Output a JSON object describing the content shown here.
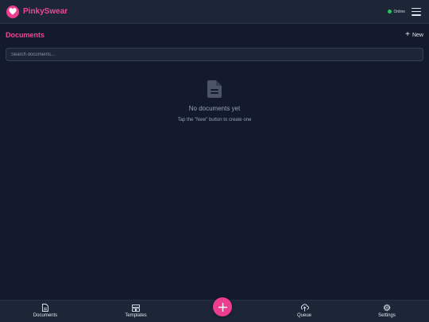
{
  "app": {
    "name": "PinkySwear",
    "status": "Online"
  },
  "colors": {
    "accent": "#ec4899",
    "background": "#131a2b",
    "bar": "#1c2636",
    "status": "#22c55e"
  },
  "header": {
    "title": "Documents",
    "new_label": "New",
    "new_icon": "plus-icon",
    "menu_icon": "hamburger-menu-icon"
  },
  "search": {
    "placeholder": "Search documents..."
  },
  "empty_state": {
    "icon": "document-icon",
    "title": "No documents yet",
    "subtitle": "Tap the \"New\" button to create one"
  },
  "nav": {
    "items": [
      {
        "label": "Documents",
        "icon": "document-icon"
      },
      {
        "label": "Templates",
        "icon": "templates-icon"
      },
      {
        "label": "Queue",
        "icon": "cloud-upload-icon"
      },
      {
        "label": "Settings",
        "icon": "gear-icon"
      }
    ],
    "fab_icon": "plus-icon"
  }
}
